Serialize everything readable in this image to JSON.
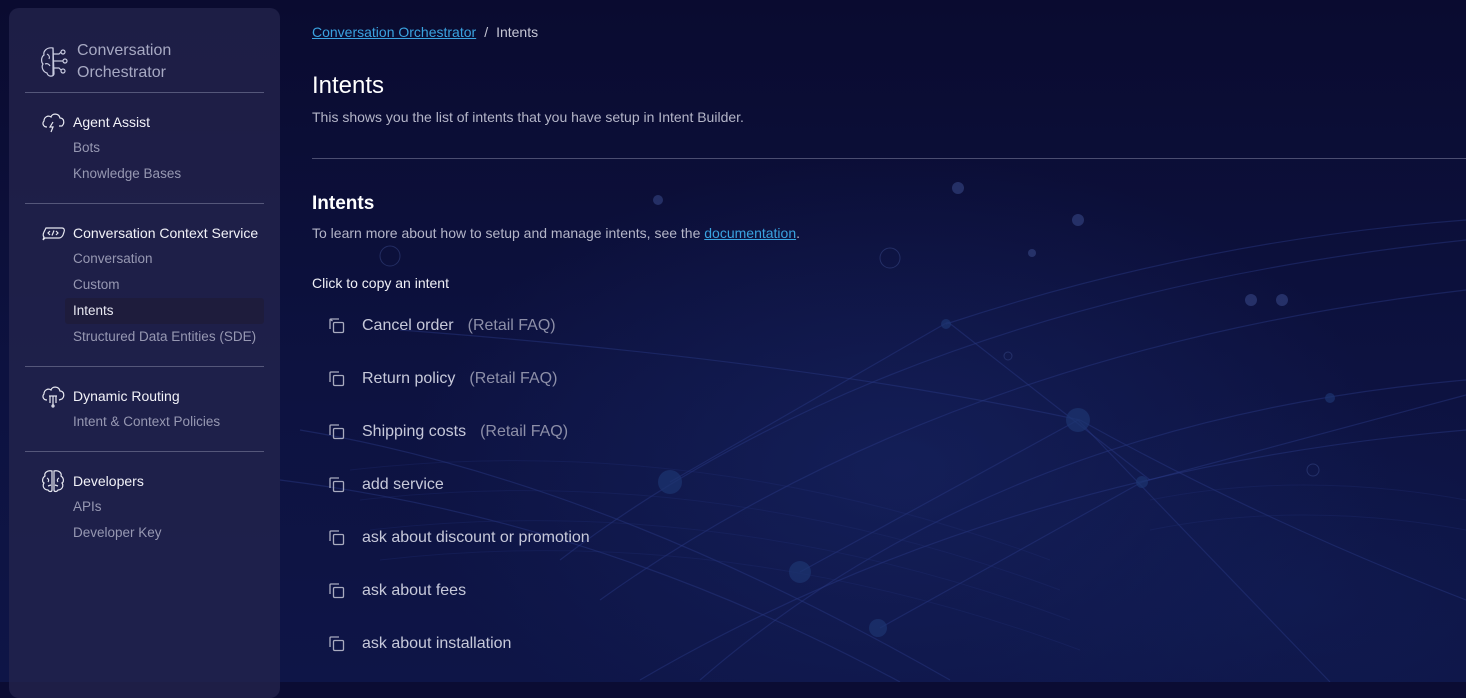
{
  "sidebar": {
    "brand": "Conversation Orchestrator",
    "sections": [
      {
        "title": "Agent Assist",
        "icon": "cloud-lightning-icon",
        "items": [
          {
            "label": "Bots",
            "active": false
          },
          {
            "label": "Knowledge Bases",
            "active": false
          }
        ]
      },
      {
        "title": "Conversation Context Service",
        "icon": "code-chat-icon",
        "items": [
          {
            "label": "Conversation",
            "active": false
          },
          {
            "label": "Custom",
            "active": false
          },
          {
            "label": "Intents",
            "active": true
          },
          {
            "label": "Structured Data Entities (SDE)",
            "active": false
          }
        ]
      },
      {
        "title": "Dynamic Routing",
        "icon": "cloud-routing-icon",
        "items": [
          {
            "label": "Intent & Context Policies",
            "active": false
          }
        ]
      },
      {
        "title": "Developers",
        "icon": "brain-icon",
        "items": [
          {
            "label": "APIs",
            "active": false
          },
          {
            "label": "Developer Key",
            "active": false
          }
        ]
      }
    ]
  },
  "breadcrumb": {
    "root": "Conversation Orchestrator",
    "separator": "/",
    "current": "Intents"
  },
  "page": {
    "title": "Intents",
    "description": "This shows you the list of intents that you have setup in Intent Builder."
  },
  "intents_section": {
    "title": "Intents",
    "desc_prefix": "To learn more about how to setup and manage intents, see the ",
    "doc_link": "documentation",
    "desc_suffix": ".",
    "copy_hint": "Click to copy an intent",
    "items": [
      {
        "name": "Cancel order",
        "group": "(Retail FAQ)"
      },
      {
        "name": "Return policy",
        "group": "(Retail FAQ)"
      },
      {
        "name": "Shipping costs",
        "group": "(Retail FAQ)"
      },
      {
        "name": "add service",
        "group": ""
      },
      {
        "name": "ask about discount or promotion",
        "group": ""
      },
      {
        "name": "ask about fees",
        "group": ""
      },
      {
        "name": "ask about installation",
        "group": ""
      }
    ]
  },
  "colors": {
    "link": "#3aa3e0",
    "background": "#0b0c33",
    "sidebar": "#26264e"
  }
}
